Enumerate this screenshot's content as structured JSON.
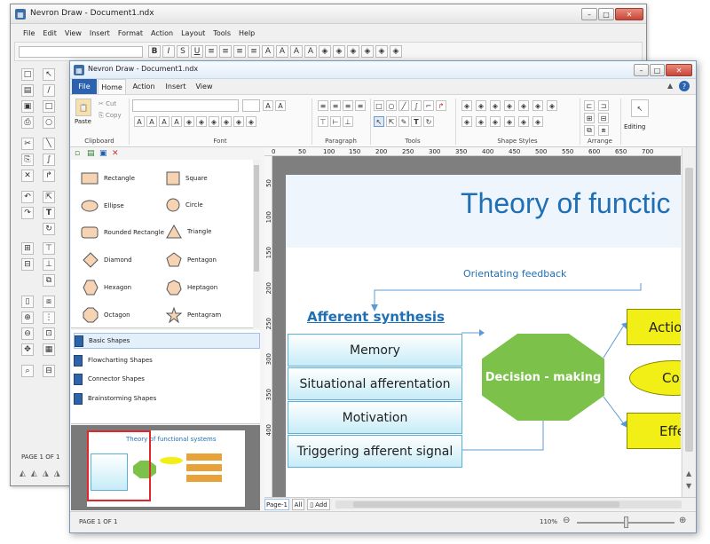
{
  "back_window": {
    "title": "Nevron Draw - Document1.ndx",
    "menu": [
      "File",
      "Edit",
      "View",
      "Insert",
      "Format",
      "Action",
      "Layout",
      "Tools",
      "Help"
    ],
    "status": "PAGE 1 OF 1"
  },
  "front_window": {
    "title": "Nevron Draw - Document1.ndx",
    "tabs": {
      "file": "File",
      "home": "Home",
      "action": "Action",
      "insert": "Insert",
      "view": "View"
    },
    "ribbon": {
      "paste": "Paste",
      "cut": "Cut",
      "copy": "Copy",
      "groups": {
        "clipboard": "Clipboard",
        "font": "Font",
        "paragraph": "Paragraph",
        "tools": "Tools",
        "shape_styles": "Shape Styles",
        "arrange": "Arrange"
      },
      "editing": "Editing"
    },
    "library": {
      "shapes": [
        {
          "name": "Rectangle",
          "icon": "rectangle-icon"
        },
        {
          "name": "Square",
          "icon": "square-icon"
        },
        {
          "name": "Ellipse",
          "icon": "ellipse-icon"
        },
        {
          "name": "Circle",
          "icon": "circle-icon"
        },
        {
          "name": "Rounded Rectangle",
          "icon": "rounded-rectangle-icon"
        },
        {
          "name": "Triangle",
          "icon": "triangle-icon"
        },
        {
          "name": "Diamond",
          "icon": "diamond-icon"
        },
        {
          "name": "Pentagon",
          "icon": "pentagon-icon"
        },
        {
          "name": "Hexagon",
          "icon": "hexagon-icon"
        },
        {
          "name": "Heptagon",
          "icon": "heptagon-icon"
        },
        {
          "name": "Octagon",
          "icon": "octagon-icon"
        },
        {
          "name": "Pentagram",
          "icon": "pentagram-icon"
        }
      ],
      "categories": [
        "Basic Shapes",
        "Flowcharting Shapes",
        "Connector Shapes",
        "Brainstorming Shapes"
      ]
    },
    "thumbnail": {
      "title": "Theory of functional systems"
    },
    "ruler_h": [
      "0",
      "50",
      "100",
      "150",
      "200",
      "250",
      "300",
      "350",
      "400",
      "450",
      "500",
      "550",
      "600",
      "650",
      "700"
    ],
    "ruler_v": [
      "50",
      "100",
      "150",
      "200",
      "250",
      "300",
      "350",
      "400"
    ],
    "diagram": {
      "title": "Theory of functic",
      "orientating_feedback": "Orientating feedback",
      "afferent_heading": "Afferent synthesis",
      "rows": [
        "Memory",
        "Situational afferentation",
        "Motivation",
        "Triggering afferent signal"
      ],
      "decision": "Decision - making",
      "action": "Action",
      "middle": "Con",
      "effect": "Effe"
    },
    "page_tabs": {
      "page1": "Page-1",
      "all": "All",
      "add": "Add"
    },
    "status": {
      "page": "PAGE 1 OF 1",
      "zoom": "110%"
    }
  },
  "colors": {
    "accent": "#2b63b0",
    "title_blue": "#1f6fb4",
    "decision_green": "#7cc24a",
    "action_yellow": "#f2ef17",
    "shape_fill": "#f6d3b3"
  }
}
